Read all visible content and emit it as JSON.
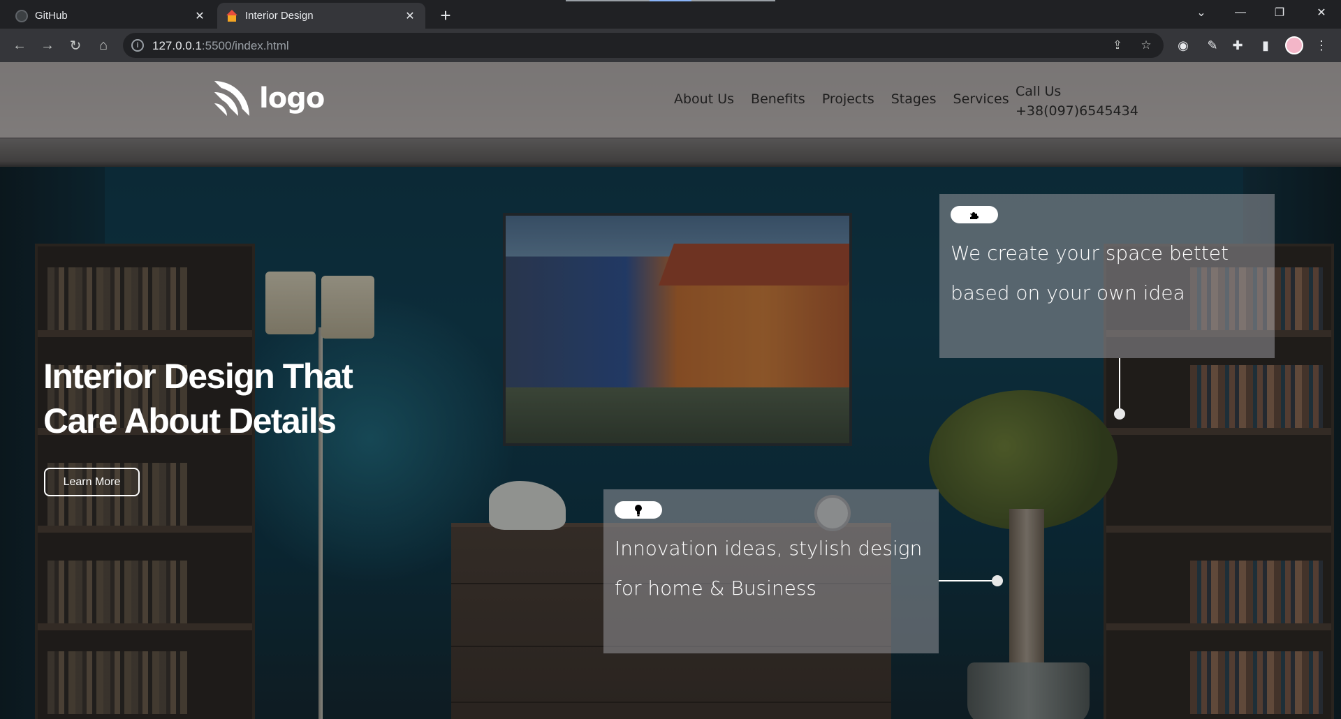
{
  "browser": {
    "tabs": [
      {
        "label": "GitHub",
        "active": false,
        "icon": "github-icon"
      },
      {
        "label": "Interior Design",
        "active": true,
        "icon": "house-icon"
      }
    ],
    "url_host": "127.0.0.1",
    "url_rest": ":5500/index.html"
  },
  "site": {
    "logo_text": "logo",
    "nav": [
      "About Us",
      "Benefits",
      "Projects",
      "Stages",
      "Services"
    ],
    "call_label": "Call Us",
    "phone": "+38(097)6545434"
  },
  "hero": {
    "title_line1": "Interior Design That",
    "title_line2": "Care About Details",
    "button": "Learn More"
  },
  "cards": [
    {
      "icon": "puzzle-icon",
      "text": "We create your space bettet based on your own idea"
    },
    {
      "icon": "lightbulb-icon",
      "text": "Innovation ideas, stylish design for home & Business"
    }
  ],
  "colors": {
    "header_bg": "#aaa4a2",
    "card_bg": "#96969b",
    "text_on_dark": "#ffffff"
  }
}
